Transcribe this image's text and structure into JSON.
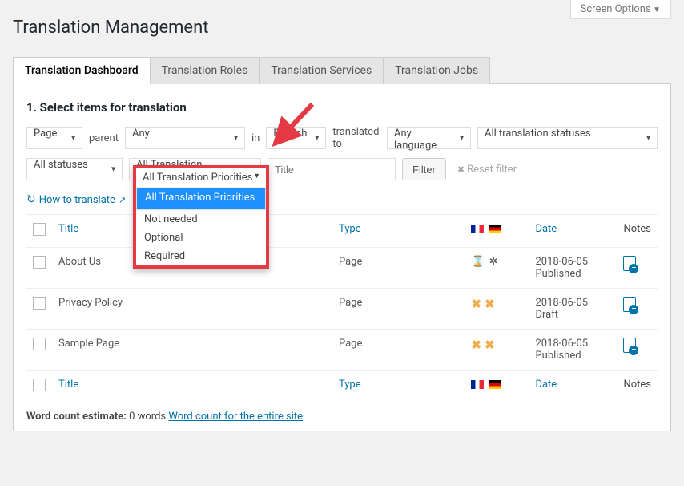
{
  "screenOptions": "Screen Options",
  "pageTitle": "Translation Management",
  "tabs": [
    "Translation Dashboard",
    "Translation Roles",
    "Translation Services",
    "Translation Jobs"
  ],
  "sectionHeading": "1. Select items for translation",
  "filters": {
    "postType": "Page",
    "parentLabel": "parent",
    "parentValue": "Any",
    "inLabel": "in",
    "sourceLang": "English",
    "translatedToLabel": "translated to",
    "targetLang": "Any language",
    "translationStatus": "All translation statuses",
    "statuses": "All statuses",
    "priorities": "All Translation Priorities",
    "titlePlaceholder": "Title",
    "filterBtn": "Filter",
    "resetBtn": "Reset filter"
  },
  "howToTranslate": "How to translate",
  "columns": {
    "title": "Title",
    "type": "Type",
    "date": "Date",
    "notes": "Notes"
  },
  "rows": [
    {
      "title": "About Us",
      "type": "Page",
      "status": "progress",
      "date": "2018-06-05",
      "state": "Published"
    },
    {
      "title": "Privacy Policy",
      "type": "Page",
      "status": "missing",
      "date": "2018-06-05",
      "state": "Draft"
    },
    {
      "title": "Sample Page",
      "type": "Page",
      "status": "missing",
      "date": "2018-06-05",
      "state": "Published"
    }
  ],
  "footerRow": {
    "title": "Title",
    "type": "Type",
    "date": "Date",
    "notes": "Notes"
  },
  "estimate": {
    "label": "Word count estimate:",
    "value": "0 words",
    "link": "Word count for the entire site"
  },
  "dropdown": {
    "header": "All Translation Priorities",
    "options": [
      "All Translation Priorities",
      "Not needed",
      "Optional",
      "Required"
    ],
    "selectedIndex": 0
  }
}
